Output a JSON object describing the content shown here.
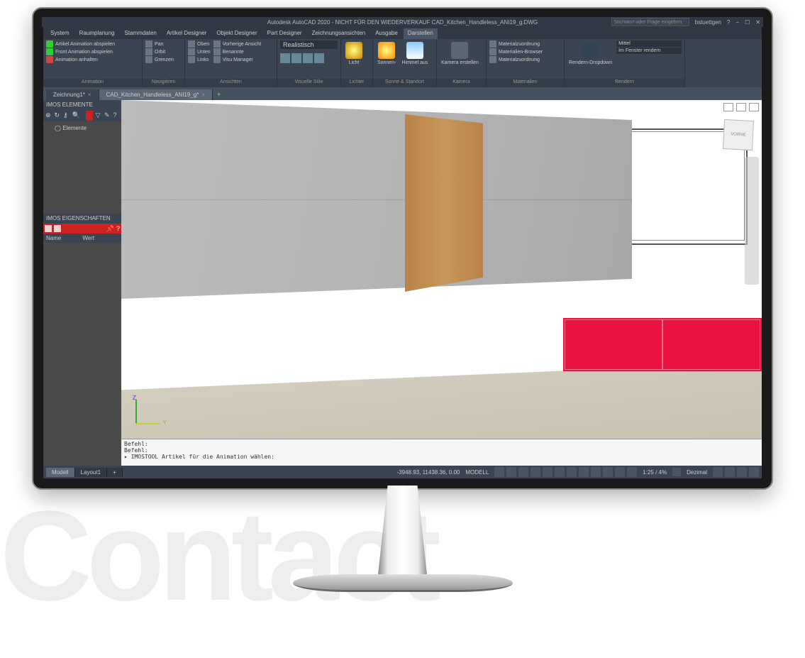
{
  "bg_text": "Contact",
  "title": "Autodesk AutoCAD 2020 - NICHT FÜR DEN WIEDERVERKAUF    CAD_Kitchen_Handleless_ANI19_g.DWG",
  "search_placeholder": "Stichwort oder Frage eingeben",
  "user": "bstuettgen",
  "menu": [
    "System",
    "Raumplanung",
    "Stammdaten",
    "Artikel Designer",
    "Objekt Designer",
    "Part Designer",
    "Zeichnungsansichten",
    "Ausgabe",
    "Darstellen"
  ],
  "menu_active": "Darstellen",
  "ribbon": {
    "animation": {
      "label": "Animation",
      "items": [
        "Artikel Animation abspielen",
        "Front Animation abspielen",
        "Animation anhalten"
      ]
    },
    "nav": {
      "label": "Navigieren",
      "items": [
        "Pan",
        "Orbit",
        "Grenzen"
      ]
    },
    "views": {
      "label": "Ansichten",
      "items": [
        "Oben",
        "Unten",
        "Links",
        "Vorherige Ansicht",
        "Benannte",
        "Visu Manager"
      ]
    },
    "vstyle": {
      "label": "Visuelle Stile",
      "dropdown": "Realistisch"
    },
    "lights": {
      "label": "Lichter",
      "btn": "Licht"
    },
    "sun": {
      "label": "Sonne & Standort",
      "btns": [
        "Sonnen-",
        "Himmel aus"
      ]
    },
    "camera": {
      "label": "Kamera",
      "btn": "Kamera erstellen"
    },
    "materials": {
      "label": "Materialien",
      "items": [
        "Materialzuordnung",
        "Materialien-Browser",
        "Materialzuordnung"
      ]
    },
    "render": {
      "label": "Rendern",
      "btn": "Rendern-Dropdown",
      "q": "Mittel",
      "mode": "Im Fenster rendern"
    }
  },
  "filetabs": [
    {
      "label": "Zeichnung1*",
      "active": false
    },
    {
      "label": "CAD_Kitchen_Handleless_ANI19_g*",
      "active": true
    }
  ],
  "sidebar": {
    "panel1_title": "IMOS ELEMENTE",
    "tree_root": "Elemente",
    "panel2_title": "IMOS EIGENSCHAFTEN",
    "col1": "Name",
    "col2": "Wert"
  },
  "viewcube": "VORNE",
  "cmd": {
    "line1": "Befehl:",
    "line2": "Befehl:",
    "prompt": "IMOSTOOL Artikel für die Animation wählen:"
  },
  "status": {
    "tabs": [
      "Modell",
      "Layout1"
    ],
    "coords": "-3948.93, 11438.36, 0.00",
    "model_label": "MODELL",
    "scale": "1:25 / 4%",
    "units": "Dezimal"
  }
}
